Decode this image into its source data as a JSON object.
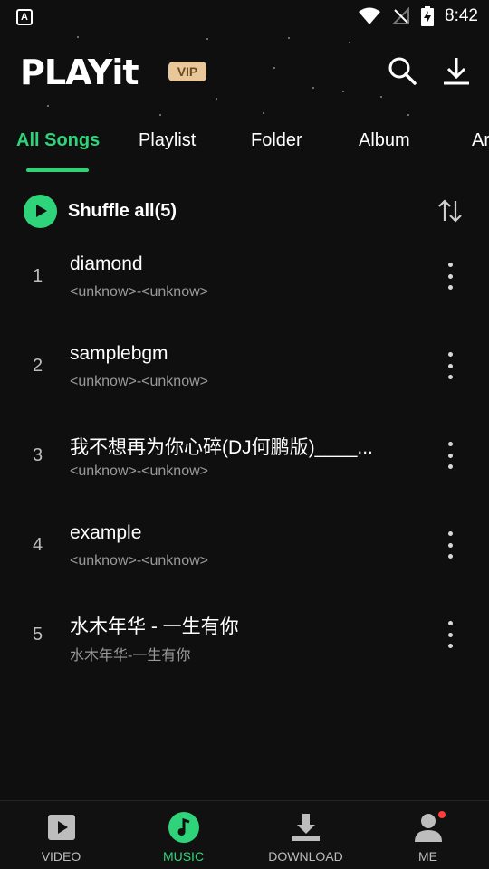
{
  "status_bar": {
    "left_icon": "A",
    "time": "8:42",
    "icons": [
      "wifi-icon",
      "no-signal-icon",
      "battery-charging-icon"
    ]
  },
  "header": {
    "logo": "PLAYit",
    "vip_badge": "VIP",
    "icons": [
      "search-icon",
      "download-icon"
    ]
  },
  "tabs": [
    "All Songs",
    "Playlist",
    "Folder",
    "Album",
    "Ar"
  ],
  "active_tab": "All Songs",
  "shuffle": {
    "label": "Shuffle all(5)"
  },
  "songs": [
    {
      "num": "1",
      "title": "diamond",
      "subtitle": "<unknow>-<unknow>"
    },
    {
      "num": "2",
      "title": "samplebgm",
      "subtitle": "<unknow>-<unknow>"
    },
    {
      "num": "3",
      "title": "我不想再为你心碎(DJ何鹏版)____...",
      "subtitle": "<unknow>-<unknow>"
    },
    {
      "num": "4",
      "title": "example",
      "subtitle": "<unknow>-<unknow>"
    },
    {
      "num": "5",
      "title": "水木年华 - 一生有你",
      "subtitle": "水木年华-一生有你"
    }
  ],
  "bottom_nav": [
    {
      "label": "VIDEO",
      "icon": "video-icon"
    },
    {
      "label": "MUSIC",
      "icon": "music-icon"
    },
    {
      "label": "DOWNLOAD",
      "icon": "download-icon"
    },
    {
      "label": "ME",
      "icon": "person-icon"
    }
  ],
  "active_nav": "MUSIC",
  "colors": {
    "accent": "#2fd47a",
    "background": "#0f0f0f",
    "vip": "#e8c89a",
    "badge": "#ff3b3b"
  }
}
